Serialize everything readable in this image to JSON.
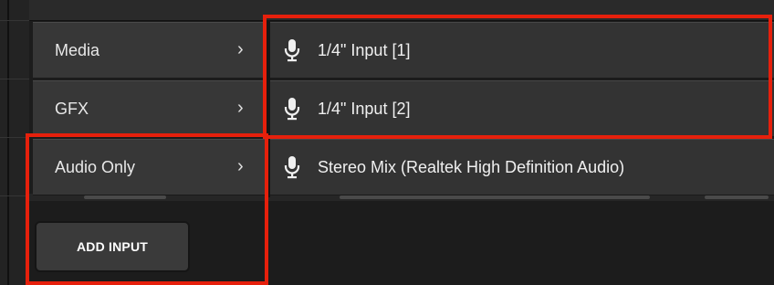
{
  "menu": {
    "items": [
      {
        "label": "Media",
        "chevron": "›"
      },
      {
        "label": "GFX",
        "chevron": "›"
      },
      {
        "label": "Audio Only",
        "chevron": "›"
      }
    ]
  },
  "submenu": {
    "items": [
      {
        "label": "1/4\" Input [1]",
        "icon": "microphone-icon"
      },
      {
        "label": "1/4\" Input [2]",
        "icon": "microphone-icon"
      },
      {
        "label": "Stereo Mix (Realtek High Definition Audio)",
        "icon": "microphone-icon"
      }
    ]
  },
  "add_input": {
    "label": "ADD INPUT"
  },
  "colors": {
    "highlight": "#e6200c",
    "menu_bg": "#373737",
    "submenu_bg": "#333333",
    "text": "#f0f0f0"
  }
}
